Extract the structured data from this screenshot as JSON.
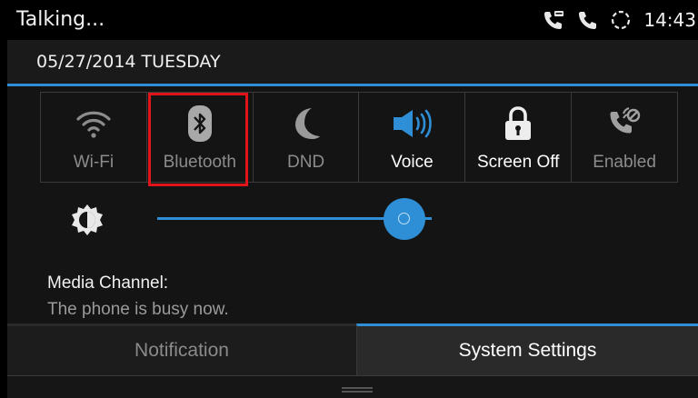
{
  "status_bar": {
    "title": "Talking...",
    "time": "14:43",
    "icons": [
      "voicemail-phone-icon",
      "phone-icon",
      "sync-icon"
    ]
  },
  "header": {
    "date": "05/27/2014 TUESDAY"
  },
  "quick_settings": [
    {
      "label": "Wi-Fi",
      "icon": "wifi-icon",
      "state": "off"
    },
    {
      "label": "Bluetooth",
      "icon": "bluetooth-icon",
      "state": "off",
      "highlighted": true
    },
    {
      "label": "DND",
      "icon": "moon-icon",
      "state": "off"
    },
    {
      "label": "Voice",
      "icon": "speaker-icon",
      "state": "on"
    },
    {
      "label": "Screen Off",
      "icon": "lock-icon",
      "state": "on"
    },
    {
      "label": "Enabled",
      "icon": "call-forward-icon",
      "state": "off"
    }
  ],
  "brightness": {
    "icon": "brightness-icon",
    "level": 0.9
  },
  "media_channel": {
    "label": "Media Channel:",
    "value": "The phone is busy now."
  },
  "tabs": [
    {
      "label": "Notification",
      "active": false
    },
    {
      "label": "System Settings",
      "active": true
    }
  ],
  "colors": {
    "accent": "#2f8fd6",
    "highlight": "#e0141b",
    "background": "#141414"
  }
}
